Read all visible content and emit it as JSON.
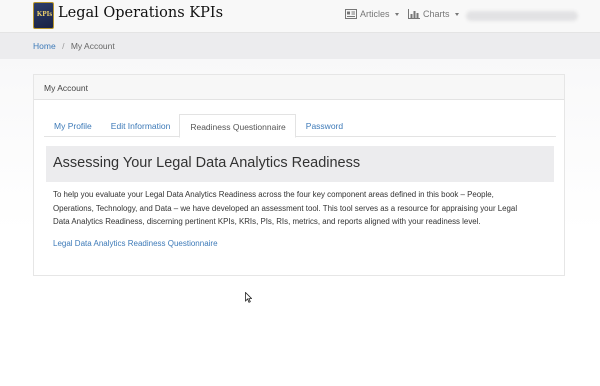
{
  "brand": {
    "logo_text": "KPIs",
    "name": "Legal Operations KPIs"
  },
  "nav": {
    "items": [
      {
        "label": "Articles",
        "icon": "article-icon"
      },
      {
        "label": "Charts",
        "icon": "bar-chart-icon"
      }
    ]
  },
  "breadcrumb": {
    "home": "Home",
    "separator": "/",
    "current": "My Account"
  },
  "panel": {
    "title": "My Account"
  },
  "tabs": [
    {
      "label": "My Profile",
      "active": false
    },
    {
      "label": "Edit Information",
      "active": false
    },
    {
      "label": "Readiness Questionnaire",
      "active": true
    },
    {
      "label": "Password",
      "active": false
    }
  ],
  "content": {
    "title": "Assessing Your Legal Data Analytics Readiness",
    "lines": [
      "To help you evaluate your Legal Data Analytics Readiness across the four key component areas defined in this book – People,",
      "Operations, Technology, and Data – we have developed an assessment tool. This tool serves as a resource for appraising your Legal",
      "Data Analytics Readiness, discerning pertinent KPIs, KRIs, PIs, RIs, metrics, and reports aligned with your readiness level."
    ],
    "link": "Legal Data Analytics Readiness Questionnaire"
  },
  "colors": {
    "link": "#3d7ab8",
    "logo_bg": "#1a2244",
    "logo_gold": "#f1d36b"
  }
}
